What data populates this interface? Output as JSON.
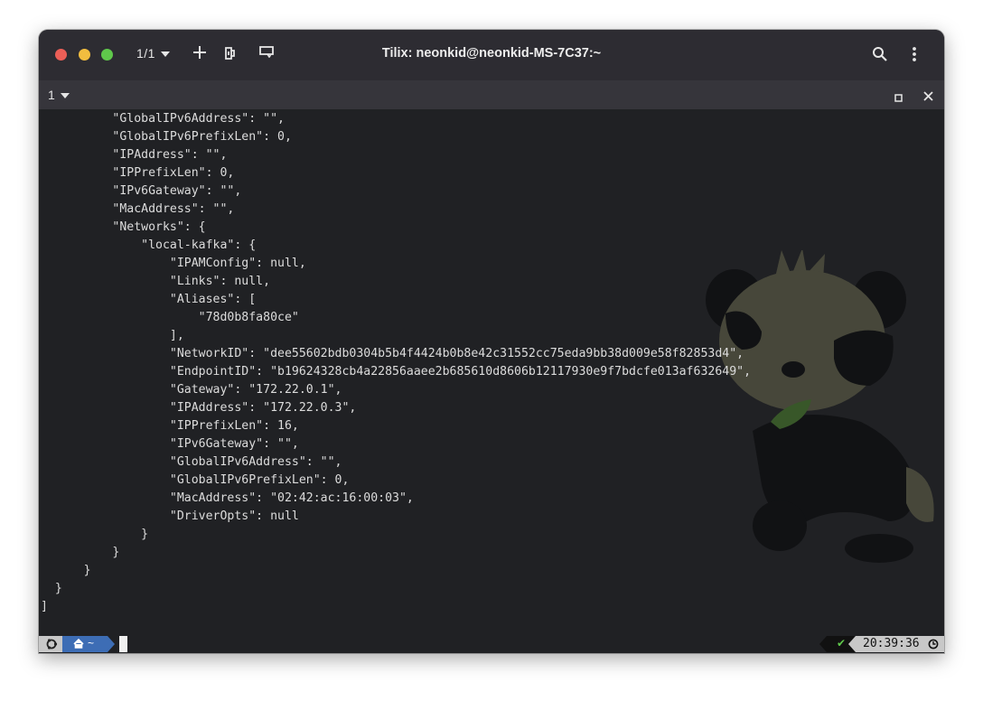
{
  "window": {
    "title": "Tilix: neonkid@neonkid-MS-7C37:~",
    "session_label": "1/1"
  },
  "tab": {
    "label": "1"
  },
  "terminal": {
    "lines": [
      "          \"GlobalIPv6Address\": \"\",",
      "          \"GlobalIPv6PrefixLen\": 0,",
      "          \"IPAddress\": \"\",",
      "          \"IPPrefixLen\": 0,",
      "          \"IPv6Gateway\": \"\",",
      "          \"MacAddress\": \"\",",
      "          \"Networks\": {",
      "              \"local-kafka\": {",
      "                  \"IPAMConfig\": null,",
      "                  \"Links\": null,",
      "                  \"Aliases\": [",
      "                      \"78d0b8fa80ce\"",
      "                  ],",
      "                  \"NetworkID\": \"dee55602bdb0304b5b4f4424b0b8e42c31552cc75eda9bb38d009e58f82853d4\",",
      "                  \"EndpointID\": \"b19624328cb4a22856aaee2b685610d8606b12117930e9f7bdcfe013af632649\",",
      "                  \"Gateway\": \"172.22.0.1\",",
      "                  \"IPAddress\": \"172.22.0.3\",",
      "                  \"IPPrefixLen\": 16,",
      "                  \"IPv6Gateway\": \"\",",
      "                  \"GlobalIPv6Address\": \"\",",
      "                  \"GlobalIPv6PrefixLen\": 0,",
      "                  \"MacAddress\": \"02:42:ac:16:00:03\",",
      "                  \"DriverOpts\": null",
      "              }",
      "          }",
      "      }",
      "  }",
      "]"
    ]
  },
  "statusbar": {
    "dir": "~",
    "time": "20:39:36",
    "ok_symbol": "✔"
  },
  "colors": {
    "titlebar": "#2d2c32",
    "tabbar": "#36353b",
    "terminal_bg": "#202124",
    "text": "#dcdcdc",
    "home_segment": "#3d6db5",
    "ok_check": "#5fc84b"
  }
}
